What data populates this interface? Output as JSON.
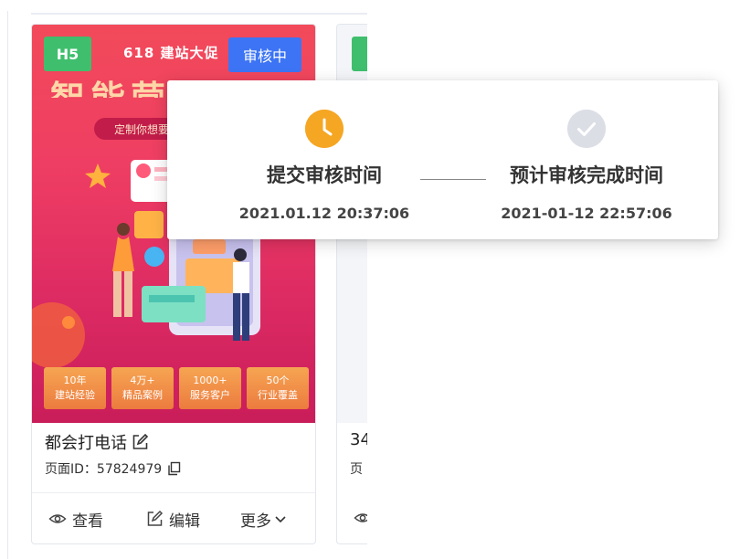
{
  "card1": {
    "tag": "H5",
    "promo": "618 建站大促",
    "status_badge": "审核中",
    "headline": "智能营销建站",
    "pill_text": "定制你想要的",
    "stats": [
      {
        "top": "10年",
        "bottom": "建站经验"
      },
      {
        "top": "4万+",
        "bottom": "精品案例"
      },
      {
        "top": "1000+",
        "bottom": "服务客户"
      },
      {
        "top": "50个",
        "bottom": "行业覆盖"
      }
    ],
    "name": "都会打电话",
    "page_id": "页面ID：57824979",
    "actions": {
      "view": "查看",
      "edit": "编辑",
      "more": "更多"
    }
  },
  "card2": {
    "name_partial": "34",
    "id_partial": "页"
  },
  "review_popup": {
    "submit_label": "提交审核时间",
    "submit_time": "2021.01.12 20:37:06",
    "eta_label": "预计审核完成时间",
    "eta_time": "2021-01-12 22:57:06"
  },
  "colors": {
    "accent_blue": "#3c74f5",
    "tag_green": "#3fbf6d",
    "clock_orange": "#f5a623",
    "check_gray": "#dcdee6"
  }
}
